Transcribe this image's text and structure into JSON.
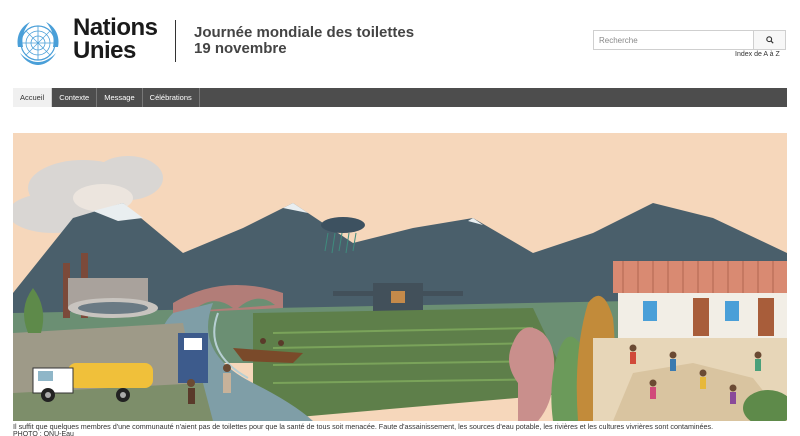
{
  "header": {
    "org_name_line1": "Nations",
    "org_name_line2": "Unies",
    "title_line1": "Journée mondiale des toilettes",
    "title_line2": "19 novembre"
  },
  "search": {
    "placeholder": "Recherche",
    "az_link": "Index de A à Z"
  },
  "nav": {
    "items": [
      "Accueil",
      "Contexte",
      "Message",
      "Célébrations"
    ],
    "active": "Accueil"
  },
  "hero": {
    "caption": "Il suffit que quelques membres d'une communauté n'aient pas de toilettes pour que la santé de tous soit menacée. Faute d'assainissement, les sources d'eau potable, les rivières et les cultures vivrières sont contaminées.",
    "credit": "PHOTO : ONU-Eau"
  },
  "colors": {
    "nav_bg": "#4d4d4d",
    "un_blue": "#4a9fd8",
    "sky": "#f6d7bb"
  }
}
